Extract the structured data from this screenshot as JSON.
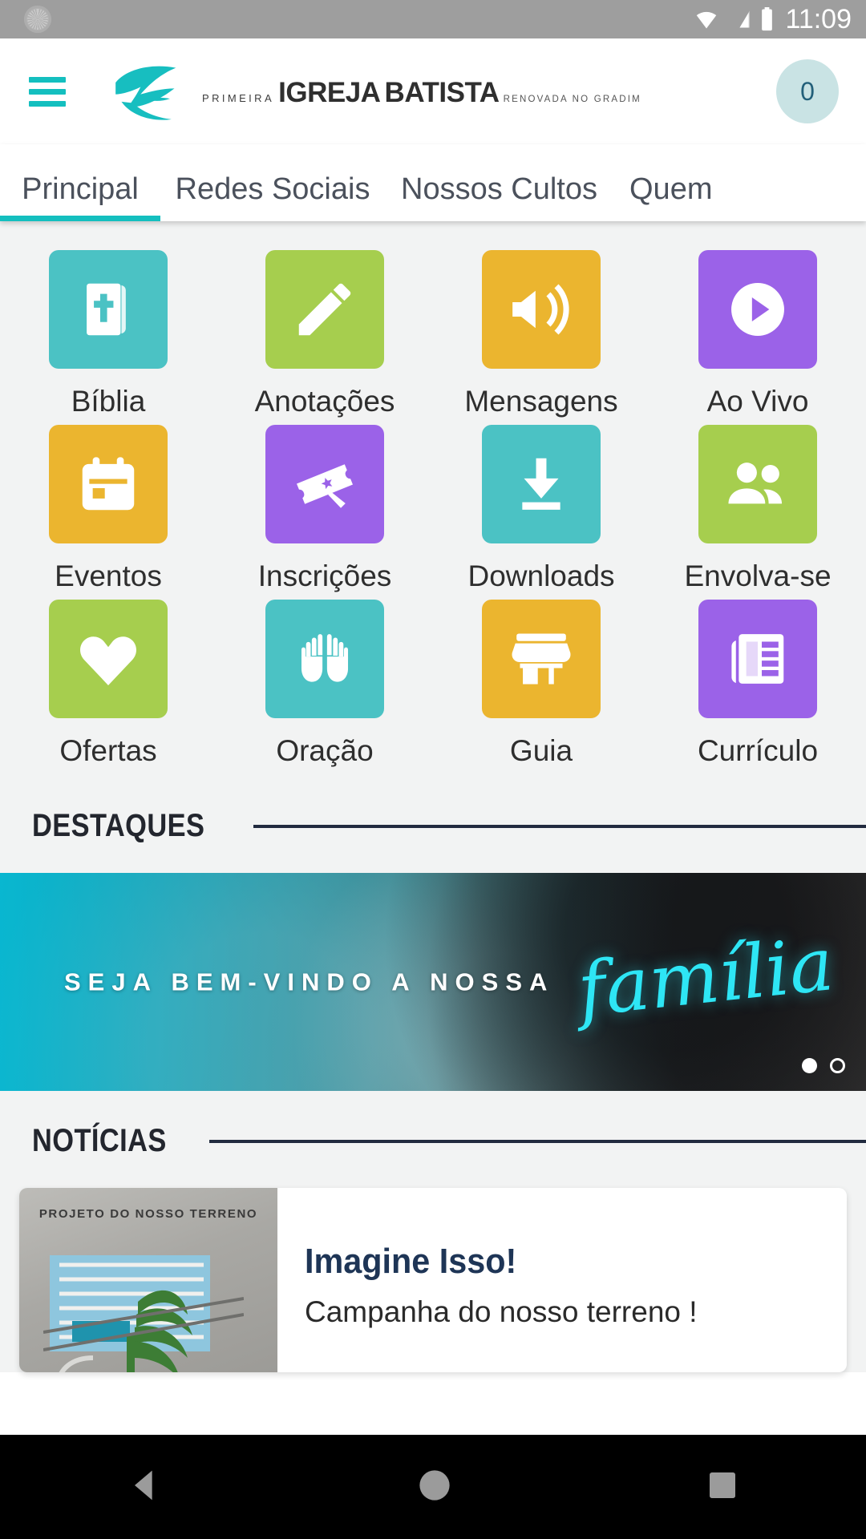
{
  "status_bar": {
    "spinner_icon": "loading-spinner-icon",
    "wifi_icon": "wifi-icon",
    "signal_icon": "cell-signal-icon",
    "battery_icon": "battery-icon",
    "time": "11:09"
  },
  "header": {
    "menu_icon": "hamburger-menu-icon",
    "logo_icon": "dove-leaf-logo-icon",
    "brand_kicker": "PRIMEIRA",
    "brand_line1": "IGREJA",
    "brand_line2": "BATISTA",
    "brand_sub": "RENOVADA NO GRADIM",
    "cart_badge": "0"
  },
  "tabs": [
    {
      "label": "Principal",
      "active": true
    },
    {
      "label": "Redes Sociais",
      "active": false
    },
    {
      "label": "Nossos Cultos",
      "active": false
    },
    {
      "label": "Quem",
      "active": false
    }
  ],
  "grid": {
    "items": [
      {
        "label": "Bíblia",
        "icon": "bible-icon",
        "color": "#4BC2C4"
      },
      {
        "label": "Anotações",
        "icon": "pencil-icon",
        "color": "#A6CE4E"
      },
      {
        "label": "Mensagens",
        "icon": "megaphone-icon",
        "color": "#EBB52F"
      },
      {
        "label": "Ao Vivo",
        "icon": "play-circle-icon",
        "color": "#9B62E8"
      },
      {
        "label": "Eventos",
        "icon": "calendar-icon",
        "color": "#EBB52F"
      },
      {
        "label": "Inscrições",
        "icon": "ticket-icon",
        "color": "#9B62E8"
      },
      {
        "label": "Downloads",
        "icon": "download-icon",
        "color": "#4BC2C4"
      },
      {
        "label": "Envolva-se",
        "icon": "people-icon",
        "color": "#A6CE4E"
      },
      {
        "label": "Ofertas",
        "icon": "heart-icon",
        "color": "#A6CE4E"
      },
      {
        "label": "Oração",
        "icon": "praying-hands-icon",
        "color": "#4BC2C4"
      },
      {
        "label": "Guia",
        "icon": "store-icon",
        "color": "#EBB52F"
      },
      {
        "label": "Currículo",
        "icon": "newspaper-icon",
        "color": "#9B62E8"
      }
    ]
  },
  "highlights": {
    "section_title": "DESTAQUES",
    "banner_kicker": "SEJA BEM-VINDO A NOSSA",
    "banner_script": "família",
    "dots": [
      {
        "active": true
      },
      {
        "active": false
      }
    ]
  },
  "news": {
    "section_title": "NOTÍCIAS",
    "items": [
      {
        "thumb_caption": "PROJETO DO NOSSO TERRENO",
        "title": "Imagine Isso!",
        "subtitle": "Campanha do nosso terreno !"
      }
    ]
  },
  "nav_bar": {
    "back_icon": "back-triangle-icon",
    "home_icon": "home-circle-icon",
    "recents_icon": "recents-square-icon"
  },
  "colors": {
    "teal": "#14BFBF",
    "green": "#A6CE4E",
    "yellow": "#EBB52F",
    "purple": "#9B62E8",
    "navy": "#222b3f",
    "bg": "#f2f3f3"
  }
}
